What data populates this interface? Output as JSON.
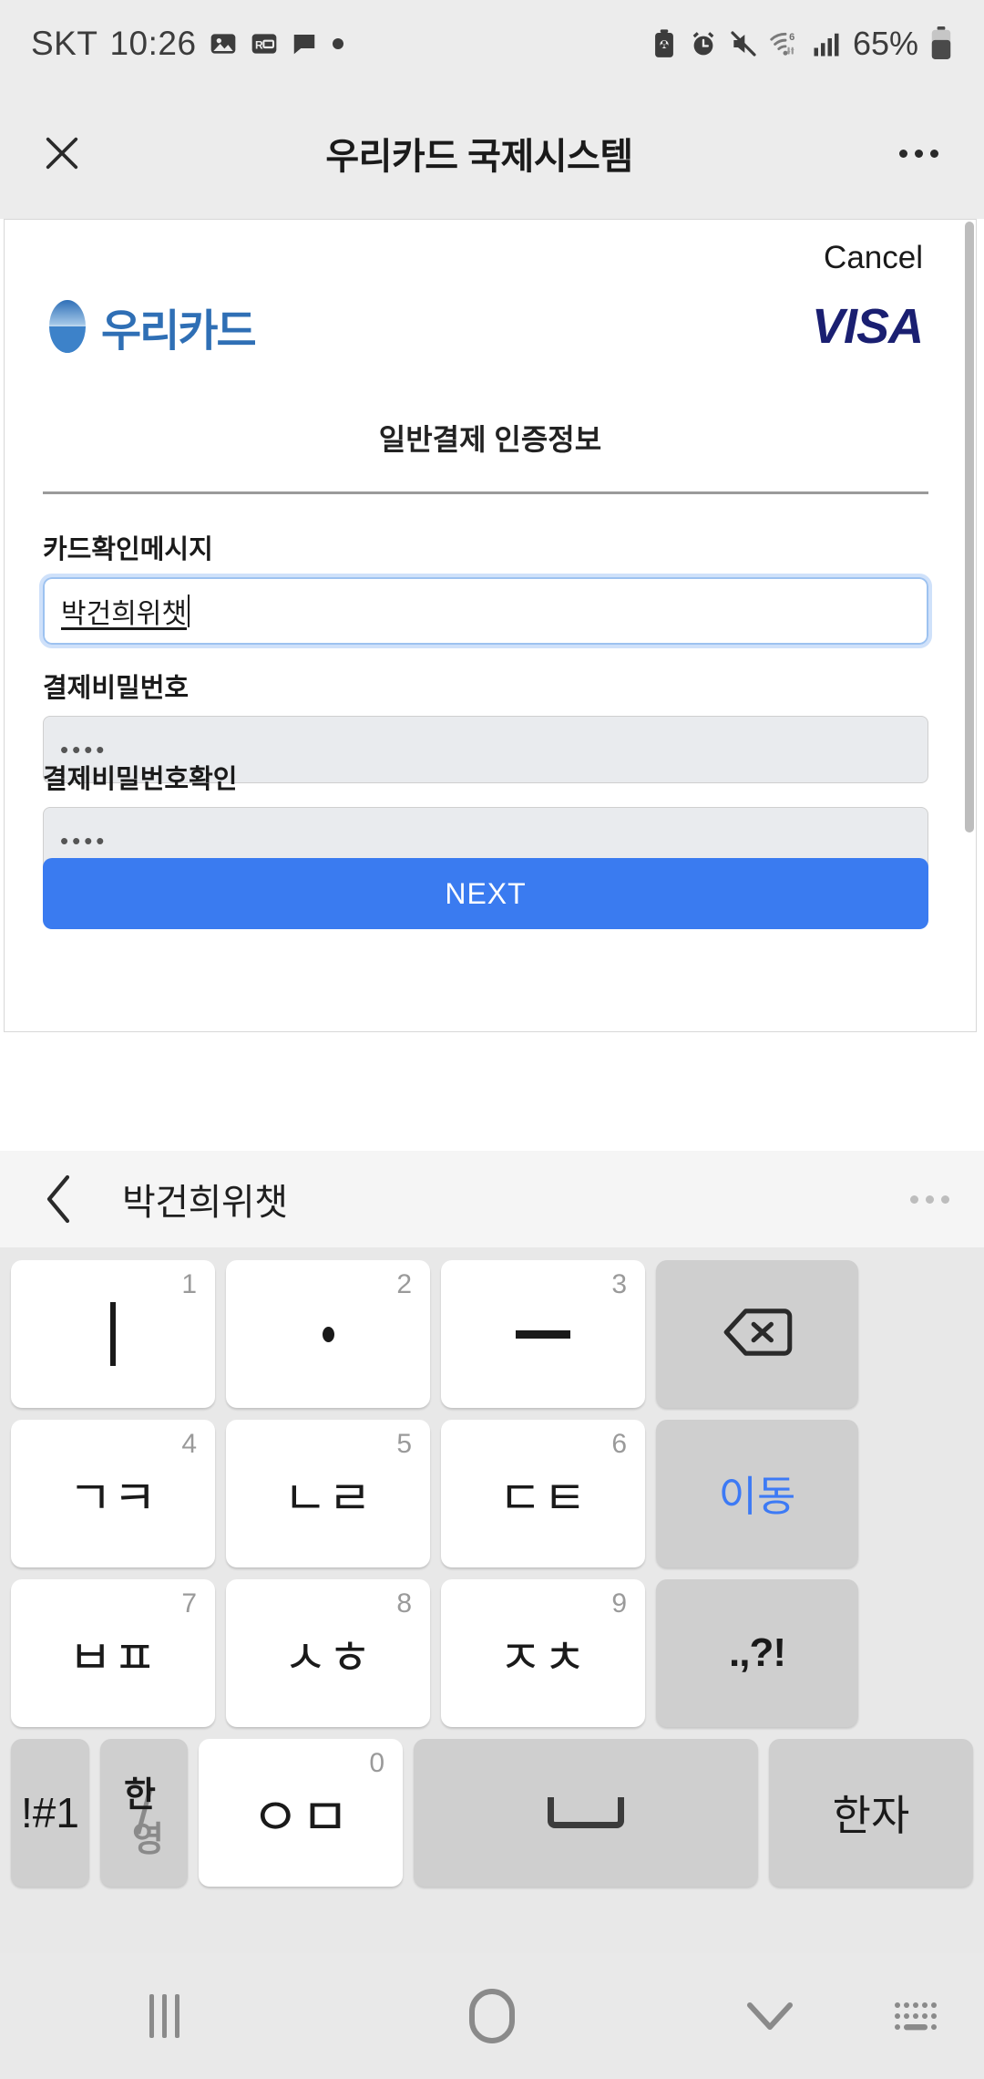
{
  "status_bar": {
    "carrier": "SKT",
    "time": "10:26",
    "battery_percent": "65%",
    "left_icons": [
      "image-icon",
      "rcs-message-icon",
      "chat-bubble-icon",
      "dot-icon"
    ],
    "right_icons": [
      "battery-saver-icon",
      "alarm-icon",
      "mute-icon",
      "wifi6-icon",
      "signal-bars-icon"
    ]
  },
  "app_header": {
    "title": "우리카드 국제시스템",
    "close_icon": "close-icon",
    "more_icon": "more-options-icon"
  },
  "card_panel": {
    "cancel_label": "Cancel",
    "brand_name": "우리카드",
    "network_logo": "VISA",
    "heading": "일반결제 인증정보",
    "fields": [
      {
        "label": "카드확인메시지",
        "value": "박건희위챗",
        "type": "text",
        "focused": true,
        "composing": true
      },
      {
        "label": "결제비밀번호",
        "value": "••••",
        "type": "password",
        "focused": false,
        "composing": false
      },
      {
        "label": "결제비밀번호확인",
        "value": "••••",
        "type": "password",
        "focused": false,
        "composing": false
      }
    ],
    "submit_label": "NEXT",
    "colors": {
      "primary_button": "#3a7bf0",
      "brand_blue": "#2f6fb5",
      "visa_navy": "#1a1f71",
      "focus_ring": "#cfe1fa"
    }
  },
  "keyboard": {
    "suggestion_bar": {
      "back_icon": "chevron-left-icon",
      "text": "박건희위챗",
      "more_icon": "more-options-icon"
    },
    "rows": [
      [
        {
          "main": "ㅣ",
          "num": "1",
          "kind": "char",
          "glyph": "vertical-bar"
        },
        {
          "main": "·",
          "num": "2",
          "kind": "char",
          "glyph": "dot"
        },
        {
          "main": "ㅡ",
          "num": "3",
          "kind": "char",
          "glyph": "horizontal-bar"
        },
        {
          "main": "",
          "num": "",
          "kind": "fn",
          "glyph": "backspace-icon",
          "name": "backspace-key"
        }
      ],
      [
        {
          "main": "ㄱㅋ",
          "num": "4",
          "kind": "char"
        },
        {
          "main": "ㄴㄹ",
          "num": "5",
          "kind": "char"
        },
        {
          "main": "ㄷㅌ",
          "num": "6",
          "kind": "char"
        },
        {
          "main": "이동",
          "num": "",
          "kind": "fn-blue",
          "name": "move-key"
        }
      ],
      [
        {
          "main": "ㅂㅍ",
          "num": "7",
          "kind": "char"
        },
        {
          "main": "ㅅㅎ",
          "num": "8",
          "kind": "char"
        },
        {
          "main": "ㅈㅊ",
          "num": "9",
          "kind": "char"
        },
        {
          "main": ".,?!",
          "num": "",
          "kind": "fn-punct",
          "name": "punctuation-key"
        }
      ]
    ],
    "bottom_row": {
      "symbols_label": "!#1",
      "lang_han": "한",
      "lang_young": "영",
      "om_main": "ㅇㅁ",
      "om_num": "0",
      "space_label": "space-bar",
      "hanja_label": "한자"
    },
    "colors": {
      "key_bg": "#ffffff",
      "fn_key_bg": "#cfcfcf",
      "keyboard_bg": "#e8e8e8",
      "accent_blue": "#3d7af5"
    }
  },
  "nav_bar": {
    "recents_icon": "recents-icon",
    "home_icon": "home-icon",
    "dismiss_keyboard_icon": "chevron-down-icon",
    "keyboard_switch_icon": "keyboard-icon"
  }
}
